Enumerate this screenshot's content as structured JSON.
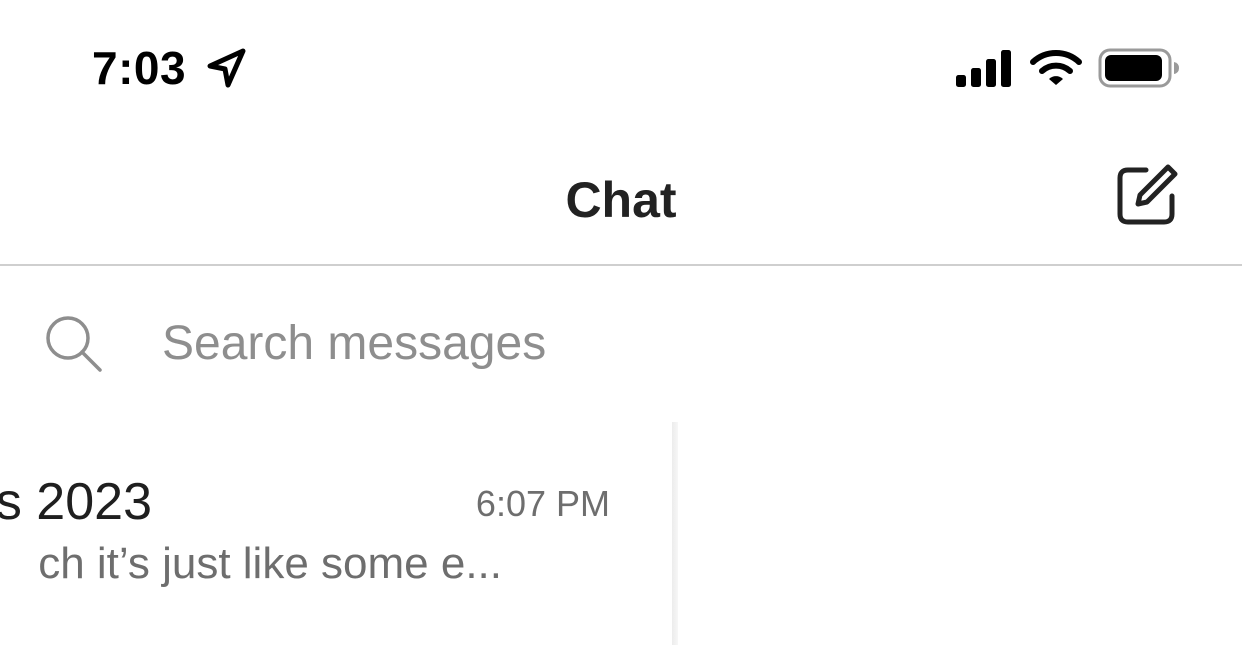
{
  "status_bar": {
    "time": "7:03",
    "icons": [
      "location-arrow-icon",
      "cellular-signal-icon",
      "wifi-icon",
      "battery-icon"
    ]
  },
  "nav": {
    "title": "Chat",
    "compose_icon": "compose-icon"
  },
  "search": {
    "icon": "search-icon",
    "placeholder": "Search messages",
    "value": ""
  },
  "conversations": [
    {
      "title": "s 2023",
      "time": "6:07 PM",
      "preview": "ch it’s just like some e..."
    }
  ],
  "colors": {
    "background": "#ffffff",
    "primary_text": "#1f1f1f",
    "secondary_text": "#6e6e6e",
    "placeholder_text": "#8e8e8e",
    "divider": "#cfcfcf"
  }
}
